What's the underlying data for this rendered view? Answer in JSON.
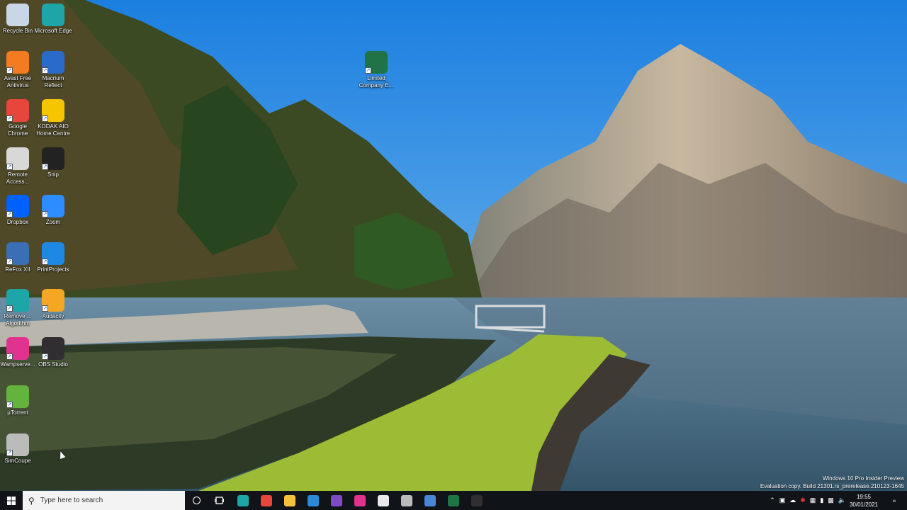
{
  "desktop": {
    "icons": [
      {
        "label": "Recycle Bin",
        "icon": "recycle-bin-icon",
        "color": "#c9d6e6"
      },
      {
        "label": "Microsoft Edge",
        "icon": "edge-icon",
        "color": "#1ea5a8"
      },
      {
        "label": "Avast Free Antivirus",
        "icon": "avast-icon",
        "color": "#f47b20"
      },
      {
        "label": "Macrium Reflect",
        "icon": "macrium-icon",
        "color": "#2a6ac8"
      },
      {
        "label": "Google Chrome",
        "icon": "chrome-icon",
        "color": "#e8453c"
      },
      {
        "label": "KODAK AIO Home Centre",
        "icon": "kodak-icon",
        "color": "#f6c500"
      },
      {
        "label": "Remote Access...",
        "icon": "remote-access-icon",
        "color": "#d8d8d8"
      },
      {
        "label": "Snip",
        "icon": "snip-icon",
        "color": "#222222"
      },
      {
        "label": "Dropbox",
        "icon": "dropbox-icon",
        "color": "#0061fe"
      },
      {
        "label": "Zoom",
        "icon": "zoom-icon",
        "color": "#2d8cff"
      },
      {
        "label": "ReFox XII",
        "icon": "refox-icon",
        "color": "#3a6fb5"
      },
      {
        "label": "PrintProjects",
        "icon": "printprojects-icon",
        "color": "#1e88e5"
      },
      {
        "label": "Remove ... Algorithm",
        "icon": "edge-icon",
        "color": "#1ea5a8"
      },
      {
        "label": "Audacity",
        "icon": "audacity-icon",
        "color": "#f5a623"
      },
      {
        "label": "Wampserve...",
        "icon": "wampserver-icon",
        "color": "#e0338f"
      },
      {
        "label": "OBS Studio",
        "icon": "obs-icon",
        "color": "#302e31"
      },
      {
        "label": "µTorrent",
        "icon": "utorrent-icon",
        "color": "#64b33d"
      },
      {
        "label": "SimCoupe",
        "icon": "simcoupe-icon",
        "color": "#bbbbbb"
      },
      {
        "label": "Limited Company E...",
        "icon": "excel-file-icon",
        "color": "#1f7346"
      }
    ],
    "watermark": {
      "line1": "Windows 10 Pro Insider Preview",
      "line2": "Evaluation copy. Build 21301.rs_prerelease.210123-1645"
    }
  },
  "taskbar": {
    "search_placeholder": "Type here to search",
    "pinned": [
      {
        "icon": "edge-icon",
        "color": "#1ea5a8"
      },
      {
        "icon": "chrome-icon",
        "color": "#e8453c"
      },
      {
        "icon": "file-explorer-icon",
        "color": "#f3c13a"
      },
      {
        "icon": "vscode-icon",
        "color": "#2a8ad8"
      },
      {
        "icon": "visual-studio-icon",
        "color": "#7d4bc4"
      },
      {
        "icon": "wampserver-icon",
        "color": "#e0338f"
      },
      {
        "icon": "notepad-icon",
        "color": "#e9e9e9"
      },
      {
        "icon": "simcoupe-icon",
        "color": "#bbbbbb"
      },
      {
        "icon": "network-app-icon",
        "color": "#4a86d6"
      },
      {
        "icon": "excel-icon",
        "color": "#1f7346"
      },
      {
        "icon": "obs-icon",
        "color": "#302e31"
      }
    ],
    "clock": {
      "time": "19:55",
      "date": "30/01/2021"
    }
  }
}
